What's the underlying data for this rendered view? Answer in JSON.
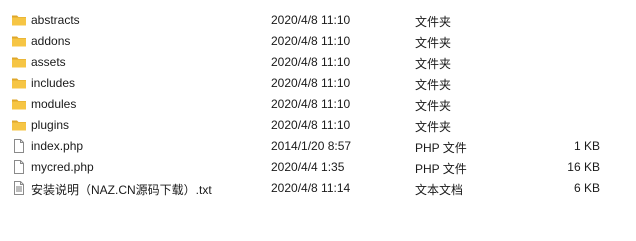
{
  "files": [
    {
      "name": "abstracts",
      "modified": "2020/4/8 11:10",
      "type": "文件夹",
      "size": "",
      "icon": "folder-icon"
    },
    {
      "name": "addons",
      "modified": "2020/4/8 11:10",
      "type": "文件夹",
      "size": "",
      "icon": "folder-icon"
    },
    {
      "name": "assets",
      "modified": "2020/4/8 11:10",
      "type": "文件夹",
      "size": "",
      "icon": "folder-icon"
    },
    {
      "name": "includes",
      "modified": "2020/4/8 11:10",
      "type": "文件夹",
      "size": "",
      "icon": "folder-icon"
    },
    {
      "name": "modules",
      "modified": "2020/4/8 11:10",
      "type": "文件夹",
      "size": "",
      "icon": "folder-icon"
    },
    {
      "name": "plugins",
      "modified": "2020/4/8 11:10",
      "type": "文件夹",
      "size": "",
      "icon": "folder-icon"
    },
    {
      "name": "index.php",
      "modified": "2014/1/20 8:57",
      "type": "PHP 文件",
      "size": "1 KB",
      "icon": "document-icon"
    },
    {
      "name": "mycred.php",
      "modified": "2020/4/4 1:35",
      "type": "PHP 文件",
      "size": "16 KB",
      "icon": "document-icon"
    },
    {
      "name": "安装说明（NAZ.CN源码下载）.txt",
      "modified": "2020/4/8 11:14",
      "type": "文本文档",
      "size": "6 KB",
      "icon": "text-file-icon"
    }
  ],
  "colors": {
    "folder": "#f6c544",
    "folder_dark": "#dfa72b",
    "text": "#1a1a1a"
  }
}
